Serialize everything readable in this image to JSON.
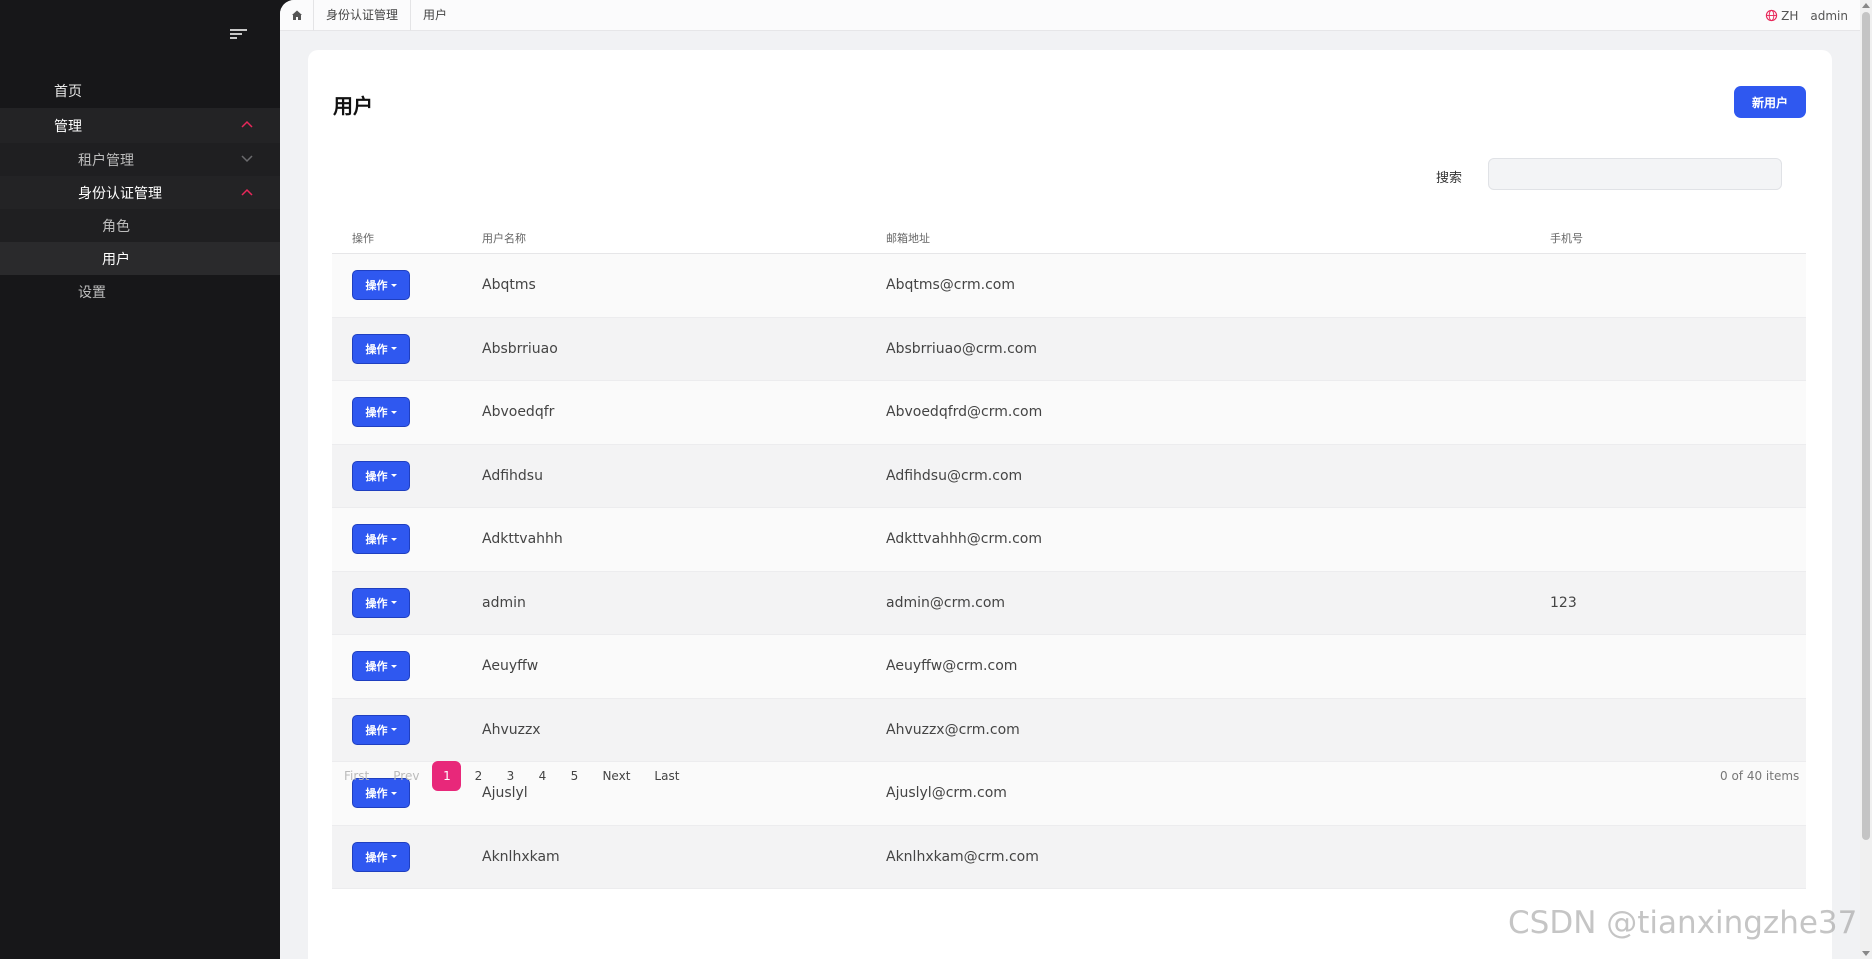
{
  "sidebar": {
    "items": [
      {
        "label": "首页"
      },
      {
        "label": "管理"
      },
      {
        "label": "租户管理"
      },
      {
        "label": "身份认证管理"
      },
      {
        "label": "角色"
      },
      {
        "label": "用户"
      },
      {
        "label": "设置"
      }
    ]
  },
  "topbar": {
    "breadcrumbs": [
      "身份认证管理",
      "用户"
    ],
    "lang": "ZH",
    "user": "admin"
  },
  "page": {
    "title": "用户",
    "new_button": "新用户",
    "search_label": "搜索",
    "search_value": ""
  },
  "table": {
    "headers": [
      "操作",
      "用户名称",
      "邮箱地址",
      "手机号"
    ],
    "action_label": "操作",
    "rows": [
      {
        "name": "Abqtms",
        "email": "Abqtms@crm.com",
        "phone": ""
      },
      {
        "name": "Absbrriuao",
        "email": "Absbrriuao@crm.com",
        "phone": ""
      },
      {
        "name": "Abvoedqfr",
        "email": "Abvoedqfrd@crm.com",
        "phone": ""
      },
      {
        "name": "Adfihdsu",
        "email": "Adfihdsu@crm.com",
        "phone": ""
      },
      {
        "name": "Adkttvahhh",
        "email": "Adkttvahhh@crm.com",
        "phone": ""
      },
      {
        "name": "admin",
        "email": "admin@crm.com",
        "phone": "123"
      },
      {
        "name": "Aeuyffw",
        "email": "Aeuyffw@crm.com",
        "phone": ""
      },
      {
        "name": "Ahvuzzx",
        "email": "Ahvuzzx@crm.com",
        "phone": ""
      },
      {
        "name": "Ajuslyl",
        "email": "Ajuslyl@crm.com",
        "phone": ""
      },
      {
        "name": "Aknlhxkam",
        "email": "Aknlhxkam@crm.com",
        "phone": ""
      }
    ]
  },
  "pagination": {
    "first": "First",
    "prev": "Prev",
    "pages": [
      "1",
      "2",
      "3",
      "4",
      "5"
    ],
    "current": "1",
    "next": "Next",
    "last": "Last",
    "info": "0 of 40 items"
  },
  "watermark": "CSDN @tianxingzhe37",
  "colors": {
    "sidebar_bg": "#171719",
    "primary": "#2f58f0",
    "active_page": "#e8287a",
    "chevron_active": "#e8285a"
  }
}
